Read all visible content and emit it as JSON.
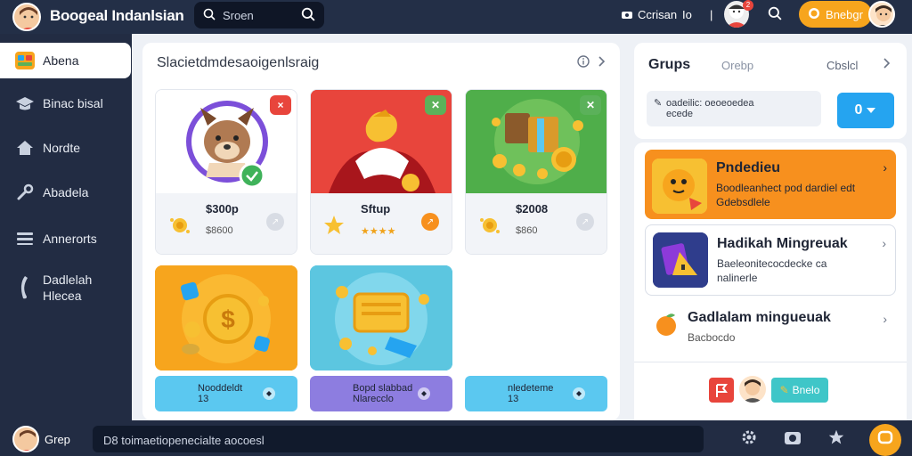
{
  "topbar": {
    "app_title": "Boogeal Indanlsian",
    "search_placeholder": "Sroen",
    "camera_label": "Ccrisan",
    "camera_sep": "Io",
    "sep2": "|",
    "notif_count": "2",
    "primary_button": "Bnebgr"
  },
  "sidebar": {
    "items": [
      {
        "label": "Abena",
        "icon": "app-icon"
      },
      {
        "label": "Binac bisal",
        "icon": "graduation-cap-icon"
      },
      {
        "label": "Nordte",
        "icon": "home-icon"
      },
      {
        "label": "Abadela",
        "icon": "wrench-icon"
      },
      {
        "label": "Annerorts",
        "icon": "list-icon"
      },
      {
        "label": "Dadlelah",
        "label2": "Hlecea",
        "icon": "leaf-icon"
      }
    ]
  },
  "main": {
    "heading": "Slacietdmdesaoigenlsraig",
    "cards": [
      {
        "price": "$300p",
        "sub": "$8600",
        "badge": "×",
        "badge_color": "#e8453c"
      },
      {
        "price": "Sftup",
        "sub": "★★★★",
        "badge": "✕",
        "badge_color": "#5bb15a"
      },
      {
        "price": "$2008",
        "sub": "$860",
        "badge": "✕",
        "badge_color": "#5bb15a"
      }
    ],
    "cards2": [
      {
        "badge": "✕"
      },
      {
        "badge": "✕"
      }
    ],
    "pills": [
      {
        "line1": "Nooddeldt",
        "line2": "13",
        "color": "#5bc8f0"
      },
      {
        "line1": "Bopd slabbad",
        "line2": "Nlarecclo",
        "color": "#8d7de0"
      },
      {
        "line1": "nledeteme",
        "line2": "13",
        "color": "#5bc8f0"
      }
    ]
  },
  "right": {
    "groups": {
      "title": "Grups",
      "tab2": "Orebp",
      "tab3": "Cbslcl",
      "box_line1": "oadeilic: oeoeoedea",
      "box_line2": "ecede",
      "select_label": "0"
    },
    "items": [
      {
        "title": "Pndedieu",
        "desc": "Boodleanhect pod dardiel edt",
        "desc2": "Gdebsdlele",
        "color": "#f7901e"
      },
      {
        "title": "Hadikah Mingreuak",
        "desc": "Baeleonitecocdecke ca",
        "desc2": "nalinerle",
        "color": "#ffffff"
      },
      {
        "title": "Gadlalam mingueuak",
        "desc": "Bacbocdo",
        "color": "#ffffff"
      }
    ],
    "footer_button": "Bnelo"
  },
  "bottom": {
    "user_name": "Grep",
    "input_text": "D8 toimaetiopenecialte aocoesl"
  },
  "colors": {
    "topbar": "#232f47",
    "accent": "#f7a51d",
    "blue": "#25a4f0"
  }
}
